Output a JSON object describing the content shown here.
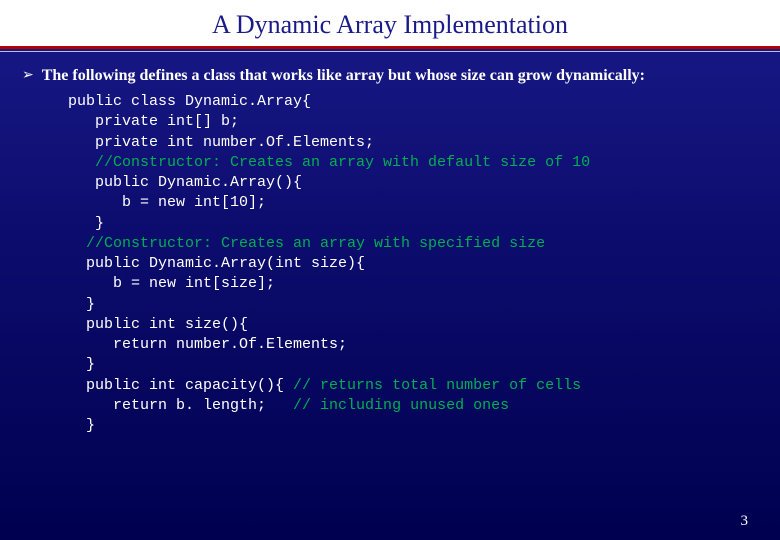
{
  "slide": {
    "title": "A Dynamic Array Implementation",
    "bullet_text": "The following defines a class that works like array but whose size can grow dynamically:",
    "page_number": "3",
    "code": {
      "l1": "public class Dynamic.Array{",
      "l2": "   private int[] b;",
      "l3": "   private int number.Of.Elements;",
      "l4": "   //Constructor: Creates an array with default size of 10",
      "l5": "   public Dynamic.Array(){",
      "l6": "      b = new int[10];",
      "l7": "   }",
      "l8": "  //Constructor: Creates an array with specified size",
      "l9": "  public Dynamic.Array(int size){",
      "l10": "     b = new int[size];",
      "l11": "  }",
      "l12": "  public int size(){",
      "l13": "     return number.Of.Elements;",
      "l14": "  }",
      "l15a": "  public int capacity(){ ",
      "l15b": "// returns total number of cells",
      "l16a": "     return b. length;   ",
      "l16b": "// including unused ones",
      "l17": "  }"
    }
  }
}
